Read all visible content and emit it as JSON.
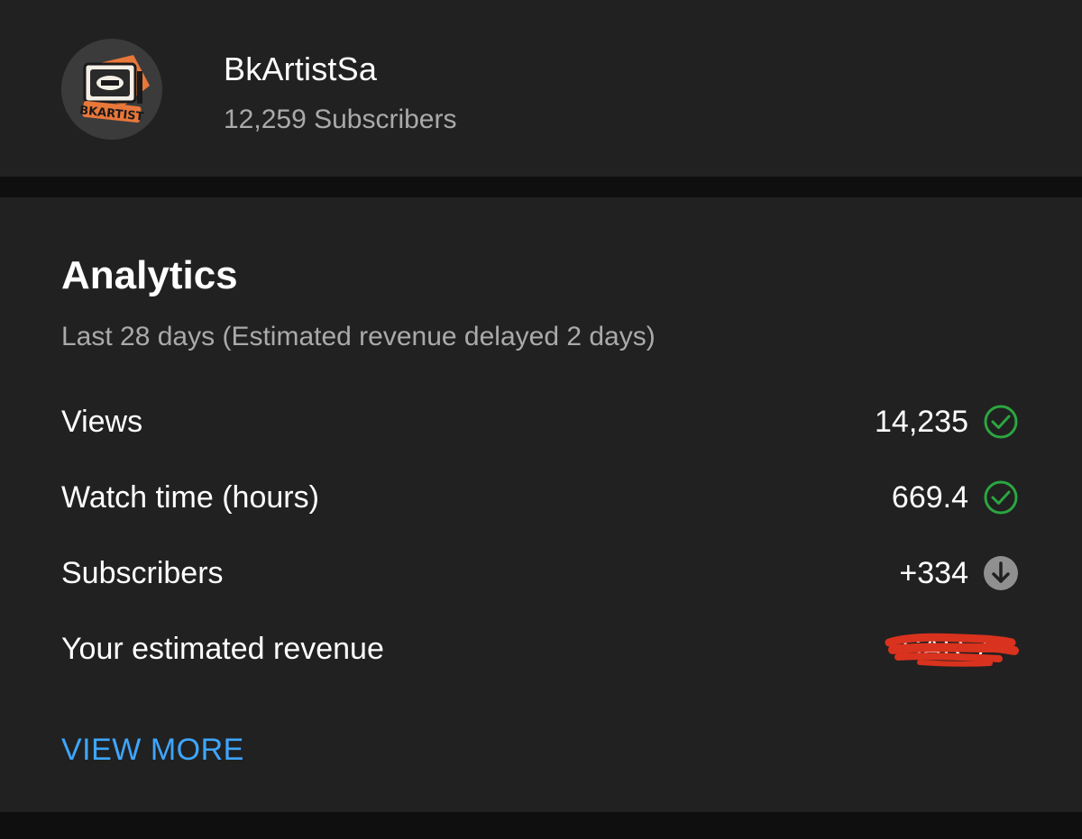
{
  "channel": {
    "name": "BkArtistSa",
    "subscribers": "12,259 Subscribers",
    "avatar_icon": "channel-logo-icon",
    "avatar_text": "BKARTIST"
  },
  "analytics": {
    "title": "Analytics",
    "period": "Last 28 days (Estimated revenue delayed 2 days)",
    "metrics": [
      {
        "label": "Views",
        "value": "14,235",
        "icon": "check-circle-icon",
        "icon_color": "#2ba640"
      },
      {
        "label": "Watch time (hours)",
        "value": "669.4",
        "icon": "check-circle-icon",
        "icon_color": "#2ba640"
      },
      {
        "label": "Subscribers",
        "value": "+334",
        "icon": "arrow-down-circle-icon",
        "icon_color": "#909090"
      },
      {
        "label": "Your estimated revenue",
        "value": "SAR 7",
        "icon": "redaction-scribble",
        "icon_color": "#d9321e"
      }
    ],
    "view_more": "VIEW MORE"
  },
  "colors": {
    "background": "#0f0f0f",
    "card": "#212121",
    "accent_link": "#3ea6ff",
    "secondary_text": "#aaaaaa"
  }
}
